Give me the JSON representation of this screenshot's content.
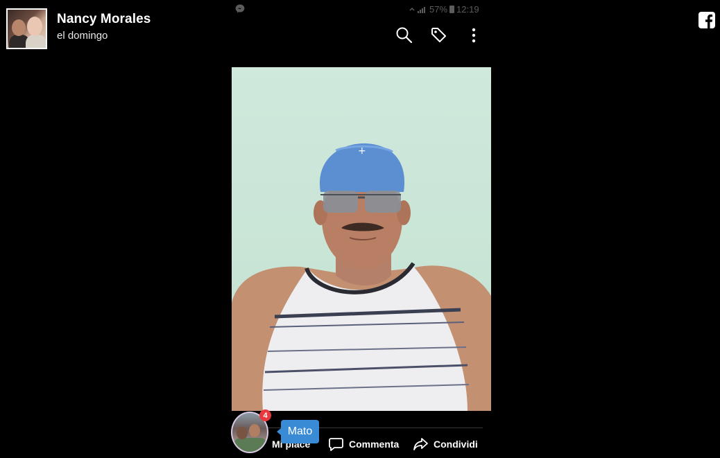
{
  "post": {
    "author_name": "Nancy Morales",
    "time": "el domingo"
  },
  "status_bar": {
    "battery": "57%",
    "clock": "12:19"
  },
  "actions": {
    "like_label": "Mi piace",
    "comment_label": "Commenta",
    "share_label": "Condividi"
  },
  "chat_head": {
    "badge_count": "4",
    "tooltip_name": "Mato"
  },
  "icons": [
    "messenger-icon",
    "search-icon",
    "tag-icon",
    "more-options-icon",
    "facebook-icon",
    "like-icon",
    "comment-icon",
    "share-icon"
  ],
  "colors": {
    "background": "#000000",
    "badge": "#e8383d",
    "tooltip": "#3a8bd6",
    "facebook_logo": "#ffffff"
  }
}
